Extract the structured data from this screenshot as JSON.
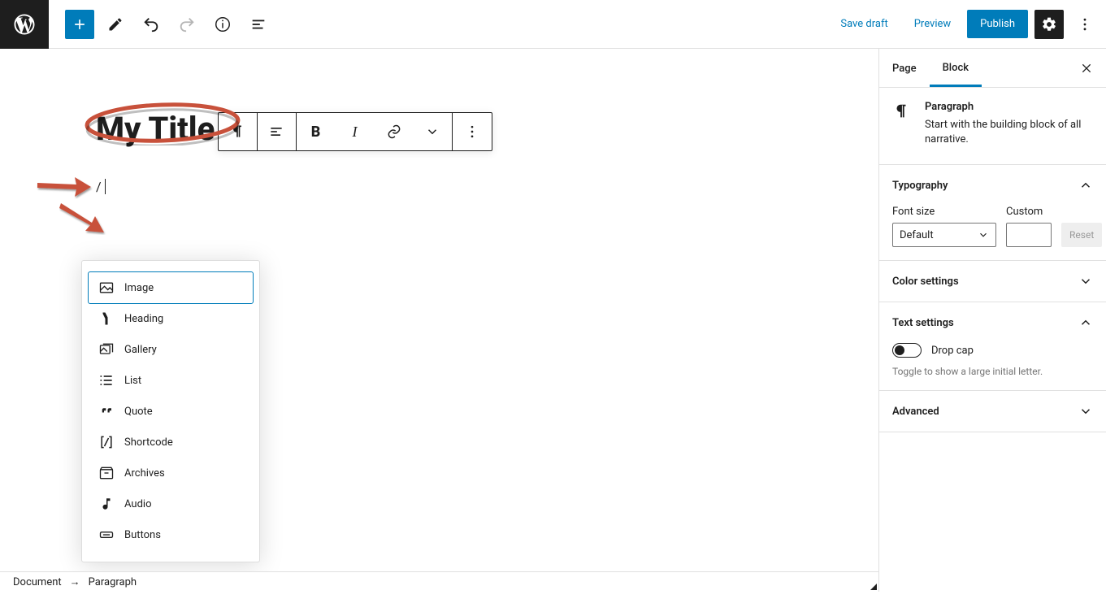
{
  "topbar": {
    "save_draft": "Save draft",
    "preview": "Preview",
    "publish": "Publish"
  },
  "editor": {
    "title": "My Title",
    "slash_input": "/"
  },
  "popup_items": [
    {
      "label": "Image"
    },
    {
      "label": "Heading"
    },
    {
      "label": "Gallery"
    },
    {
      "label": "List"
    },
    {
      "label": "Quote"
    },
    {
      "label": "Shortcode"
    },
    {
      "label": "Archives"
    },
    {
      "label": "Audio"
    },
    {
      "label": "Buttons"
    }
  ],
  "sidebar": {
    "tabs": {
      "page": "Page",
      "block": "Block"
    },
    "block_head": {
      "title": "Paragraph",
      "desc": "Start with the building block of all narrative."
    },
    "typography": {
      "title": "Typography",
      "font_size_label": "Font size",
      "custom_label": "Custom",
      "default_option": "Default",
      "reset": "Reset"
    },
    "color": {
      "title": "Color settings"
    },
    "text": {
      "title": "Text settings",
      "drop_cap": "Drop cap",
      "hint": "Toggle to show a large initial letter."
    },
    "advanced": {
      "title": "Advanced"
    }
  },
  "footer": {
    "crumb1": "Document",
    "crumb2": "Paragraph"
  }
}
